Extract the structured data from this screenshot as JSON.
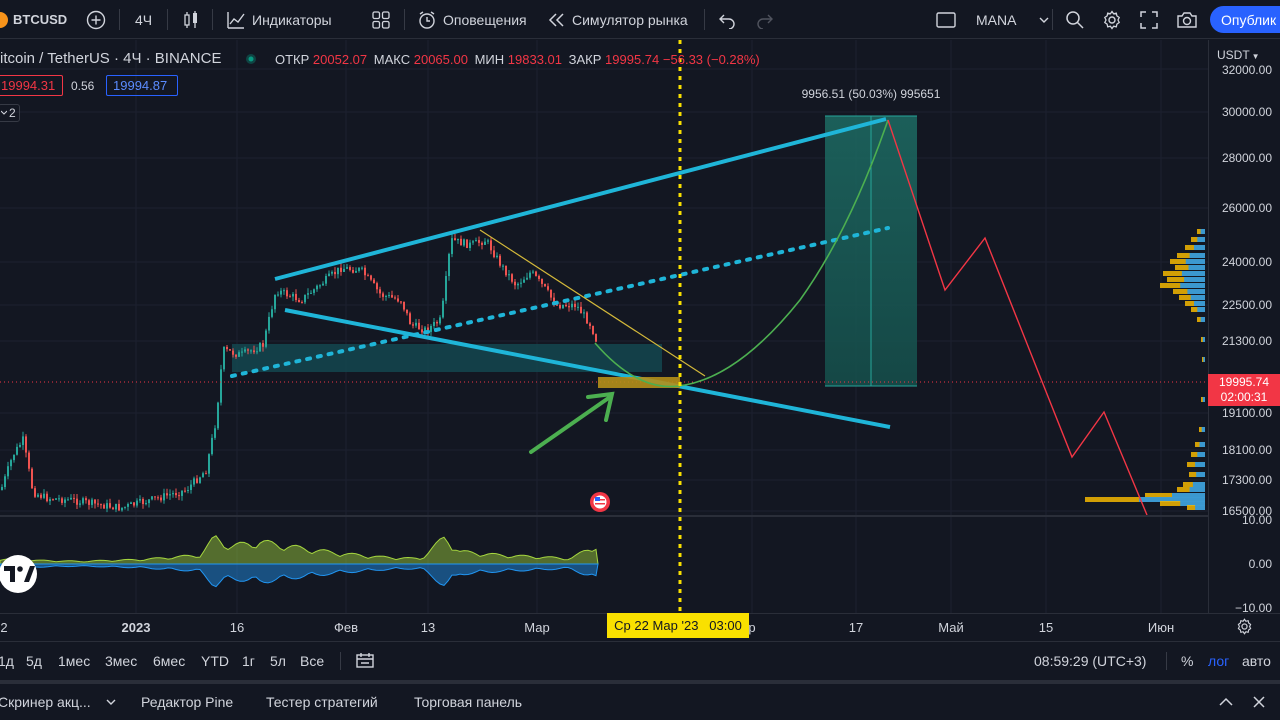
{
  "toolbar": {
    "symbol": "BTCUSD",
    "interval": "4Ч",
    "indicators_label": "Индикаторы",
    "alerts_label": "Оповещения",
    "replay_label": "Симулятор рынка",
    "layout_name": "MANA",
    "publish_label": "Опублик"
  },
  "legend": {
    "title": "itcoin / TetherUS · 4Ч · BINANCE",
    "open_label": "ОТКР",
    "open_value": "20052.07",
    "high_label": "МАКС",
    "high_value": "20065.00",
    "low_label": "МИН",
    "low_value": "19833.01",
    "close_label": "ЗАКР",
    "close_value": "19995.74",
    "change": "−56.33 (−0.28%)",
    "sell_price": "19994.31",
    "spread": "0.56",
    "buy_price": "19994.87",
    "collapsed_count": "2"
  },
  "chart": {
    "currency": "USDT",
    "price_ticks": [
      "32000.00",
      "30000.00",
      "28000.00",
      "26000.00",
      "24000.00",
      "22500.00",
      "21300.00",
      "19100.00",
      "18100.00",
      "17300.00",
      "16500.00"
    ],
    "last_price": "19995.74",
    "countdown": "02:00:31",
    "position_label": "9956.51 (50.03%) 995651",
    "indicator_ticks": [
      "10.00",
      "0.00",
      "−10.00"
    ],
    "crosshair_time": "Ср 22 Мар '23   03:00",
    "time_ticks": [
      "2",
      "2023",
      "16",
      "Фев",
      "13",
      "Мар",
      "р",
      "17",
      "Май",
      "15",
      "Июн"
    ],
    "colors": {
      "up": "#26a69a",
      "down": "#ef5350",
      "trendline": "#1fb5d8",
      "crosshair": "#f9e000",
      "projection": "#4caf50",
      "projection_down": "#f23645"
    }
  },
  "range_bar": {
    "ranges": [
      "1д",
      "5д",
      "1мес",
      "3мес",
      "6мес",
      "YTD",
      "1г",
      "5л",
      "Все"
    ],
    "clock": "08:59:29 (UTC+3)",
    "percent_label": "%",
    "log_label": "лог",
    "auto_label": "авто"
  },
  "bottom_tabs": [
    "Скринер акц...",
    "Редактор Pine",
    "Тестер стратегий",
    "Торговая панель"
  ]
}
